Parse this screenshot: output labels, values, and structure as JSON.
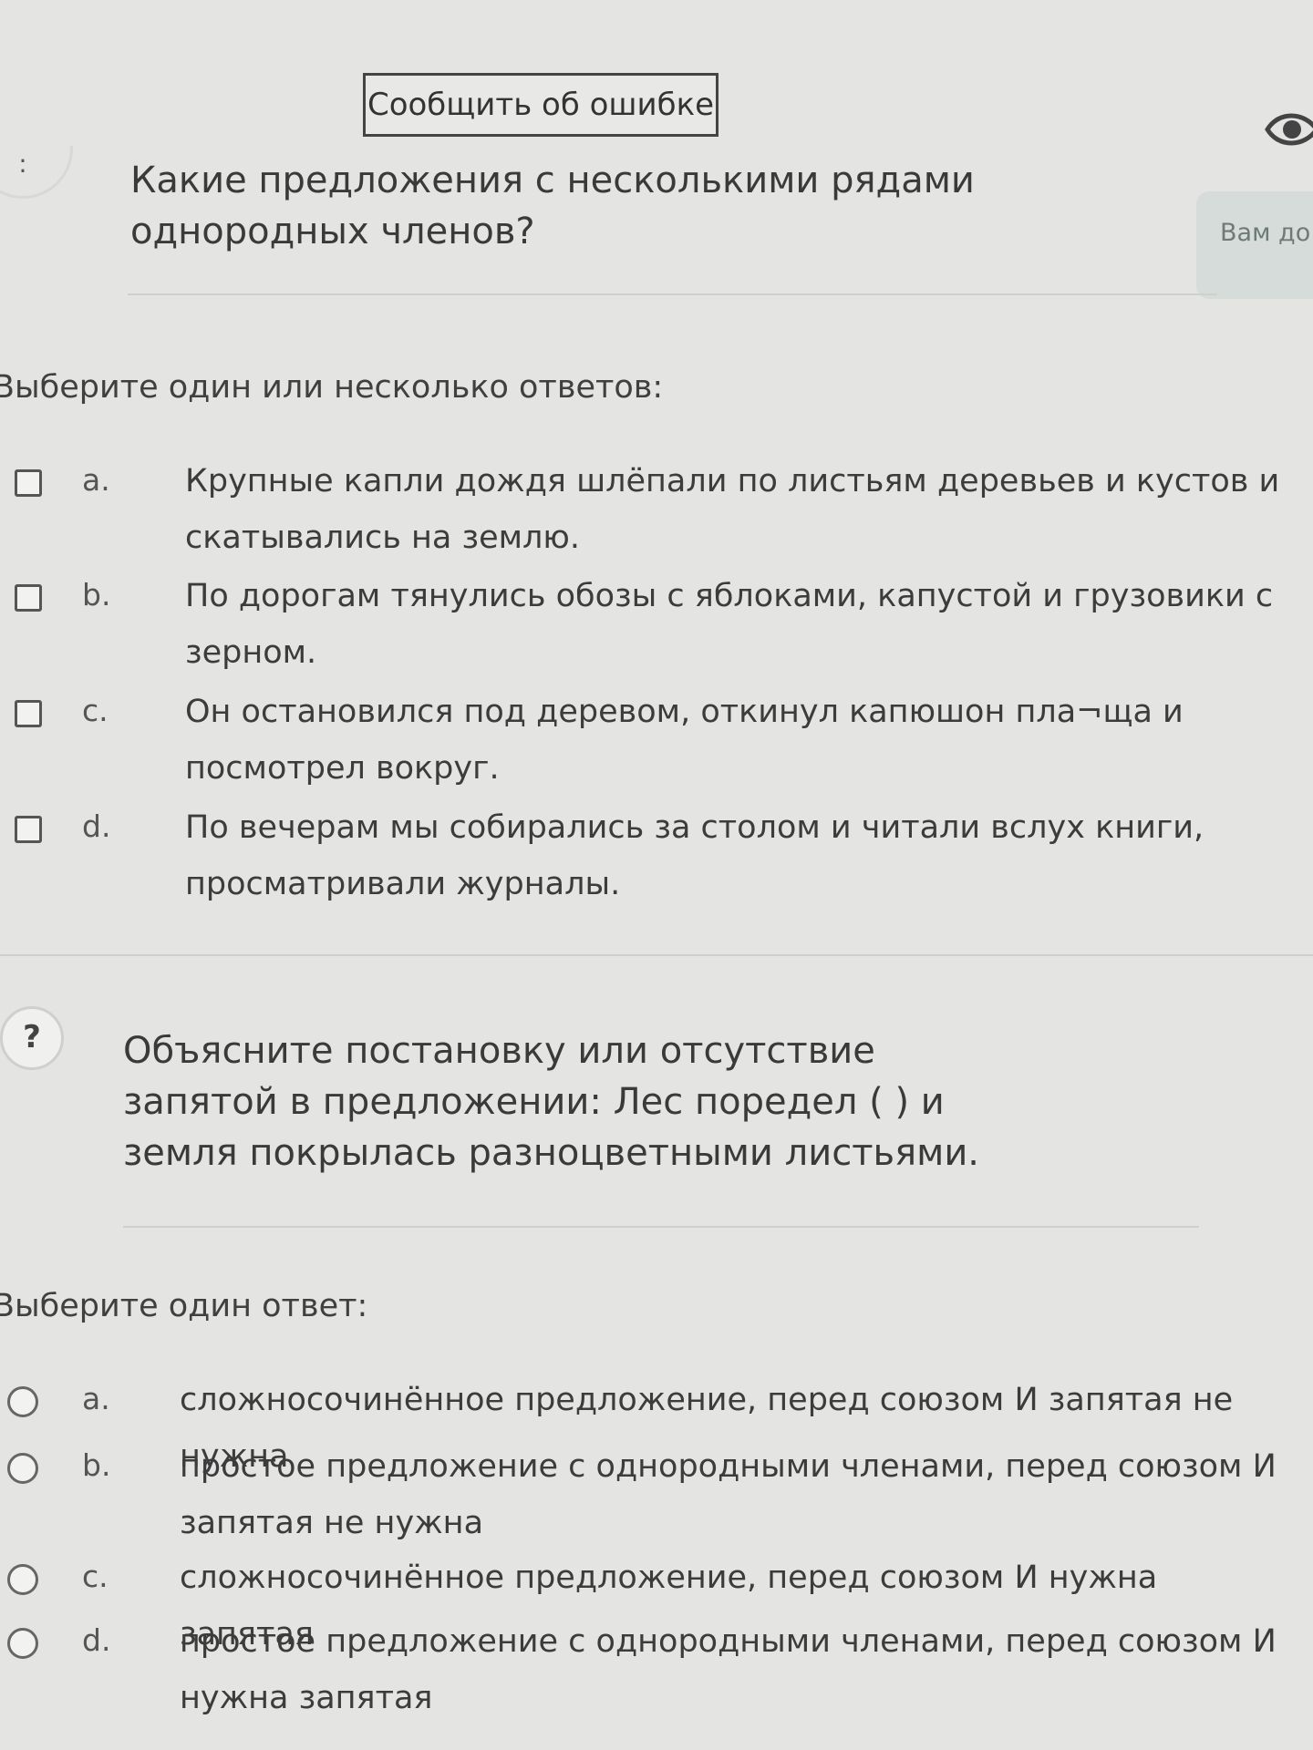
{
  "report_button": {
    "label": "Сообщить об ошибке"
  },
  "hint_panel": {
    "label": "Вам до"
  },
  "question1": {
    "badge": ":",
    "text": "Какие предложения с несколькими рядами однородных членов?",
    "instruction": "Выберите один или несколько ответов:",
    "options": [
      {
        "letter": "a.",
        "text": "Крупные капли дождя шлёпали по листьям деревьев и кустов и скатывались на землю."
      },
      {
        "letter": "b.",
        "text": "По дорогам тянулись обозы с яблоками, капустой и грузовики с зерном."
      },
      {
        "letter": "c.",
        "text": "Он остановился под деревом, откинул капюшон пла¬ща и посмотрел вокруг."
      },
      {
        "letter": "d.",
        "text": "По вечерам мы собирались за столом и читали вслух книги, просматривали журналы."
      }
    ]
  },
  "question2": {
    "badge": "?",
    "text": "Объясните постановку или отсутствие запятой в предложении: Лес поредел ( ) и земля покрылась разноцветными листьями.",
    "instruction": "Выберите один ответ:",
    "options": [
      {
        "letter": "a.",
        "text": "сложносочинённое предложение, перед союзом И запятая не нужна"
      },
      {
        "letter": "b.",
        "text": "простое предложение с однородными членами, перед союзом И запятая не нужна"
      },
      {
        "letter": "c.",
        "text": "сложносочинённое предложение, перед союзом И нужна запятая"
      },
      {
        "letter": "d.",
        "text": "простое предложение с однородными членами, перед союзом И нужна запятая"
      }
    ]
  }
}
